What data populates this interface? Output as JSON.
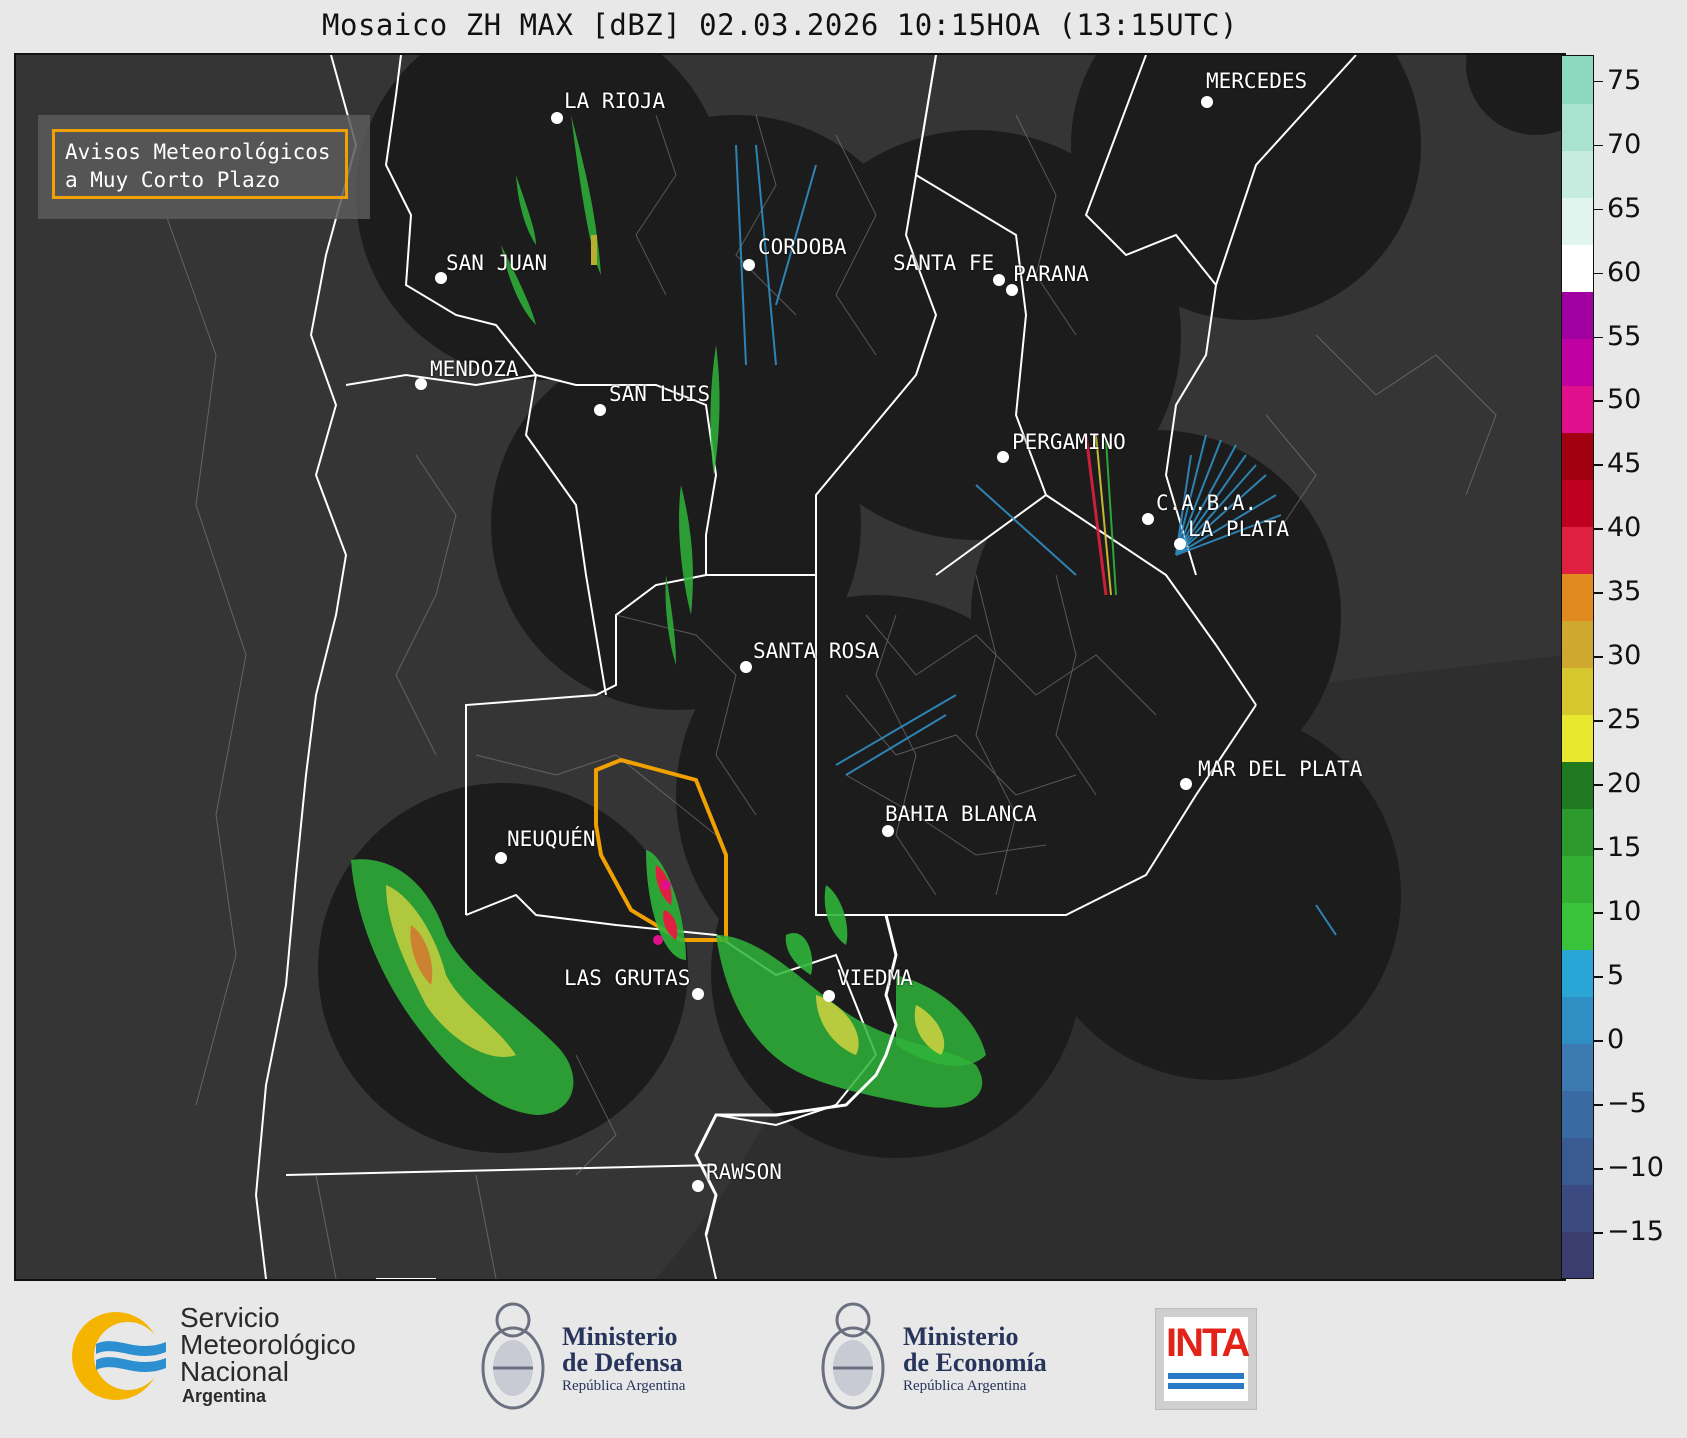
{
  "title": "Mosaico ZH MAX [dBZ] 02.03.2026 10:15HOA (13:15UTC)",
  "notice": {
    "line1": "Avisos Meteorológicos",
    "line2": "a Muy Corto Plazo",
    "border_color": "#f0a000"
  },
  "cities": [
    {
      "name": "LA RIOJA"
    },
    {
      "name": "MERCEDES"
    },
    {
      "name": "CORDOBA"
    },
    {
      "name": "SAN JUAN"
    },
    {
      "name": "SANTA FE"
    },
    {
      "name": "PARANA"
    },
    {
      "name": "MENDOZA"
    },
    {
      "name": "SAN LUIS"
    },
    {
      "name": "PERGAMINO"
    },
    {
      "name": "C.A.B.A."
    },
    {
      "name": "LA PLATA"
    },
    {
      "name": "SANTA ROSA"
    },
    {
      "name": "MAR DEL PLATA"
    },
    {
      "name": "BAHIA BLANCA"
    },
    {
      "name": "NEUQUÉN"
    },
    {
      "name": "LAS GRUTAS"
    },
    {
      "name": "VIEDMA"
    },
    {
      "name": "RAWSON"
    }
  ],
  "colorbar": {
    "min": -18.5,
    "max": 77,
    "ticks": [
      "75",
      "70",
      "65",
      "60",
      "55",
      "50",
      "45",
      "40",
      "35",
      "30",
      "25",
      "20",
      "15",
      "10",
      "5",
      "0",
      "−5",
      "−10",
      "−15"
    ],
    "colors": [
      "#3a3d6e",
      "#3b4a80",
      "#3a5a92",
      "#3a6aa2",
      "#3d7ab2",
      "#2f8fc4",
      "#2aa6d6",
      "#39c33a",
      "#33b033",
      "#2d9a2d",
      "#1f7a1f",
      "#e8e830",
      "#d8c830",
      "#d0a830",
      "#e08a20",
      "#e02040",
      "#c00020",
      "#a00010",
      "#e0108c",
      "#c000a0",
      "#a000a0",
      "#ffffff",
      "#e0f5ee",
      "#c5ecdf",
      "#a9e3cf",
      "#8dd9bf"
    ]
  },
  "footer": {
    "smn": {
      "line1": "Servicio",
      "line2": "Meteorológico",
      "line3": "Nacional",
      "line4": "Argentina"
    },
    "defensa": {
      "line1": "Ministerio",
      "line2": "de Defensa",
      "line3": "República Argentina"
    },
    "economia": {
      "line1": "Ministerio",
      "line2": "de Economía",
      "line3": "República Argentina"
    },
    "inta": {
      "text": "INTA"
    }
  }
}
